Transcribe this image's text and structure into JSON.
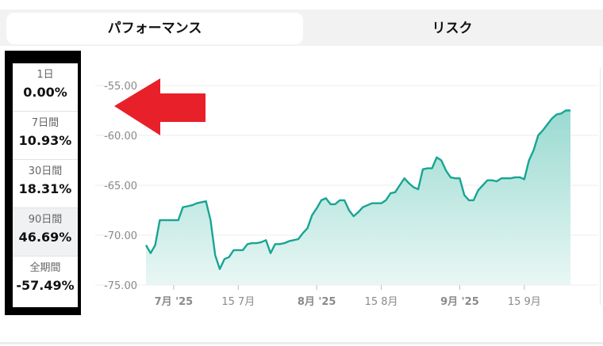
{
  "tabs": {
    "performance": "パフォーマンス",
    "risk": "リスク"
  },
  "periods": [
    {
      "label": "1日",
      "value": "0.00%"
    },
    {
      "label": "7日間",
      "value": "10.93%"
    },
    {
      "label": "30日間",
      "value": "18.31%"
    },
    {
      "label": "90日間",
      "value": "46.69%"
    },
    {
      "label": "全期間",
      "value": "-57.49%"
    }
  ],
  "selected_period": "90日間",
  "colors": {
    "line": "#17a594",
    "fill_top": "#8fd6cc",
    "fill_bottom": "#e6f6f3",
    "arrow": "#e8202a",
    "panel_border": "#000000"
  },
  "annotation_icon": "red-left-arrow-icon",
  "chart_data": {
    "type": "area",
    "title": "",
    "xlabel": "",
    "ylabel": "",
    "ylim": [
      -75,
      -55
    ],
    "yticks": [
      "-55.00",
      "-60.00",
      "-65.00",
      "-70.00",
      "-75.00"
    ],
    "xticks": [
      {
        "label": "7月 '25",
        "bold": true
      },
      {
        "label": "15 7月",
        "bold": false
      },
      {
        "label": "8月 '25",
        "bold": true
      },
      {
        "label": "15 8月",
        "bold": false
      },
      {
        "label": "9月 '25",
        "bold": true
      },
      {
        "label": "15 9月",
        "bold": false
      }
    ],
    "x_range": [
      "2025-06-25",
      "2025-09-25"
    ],
    "x_tick_dates": [
      "2025-07-01",
      "2025-07-15",
      "2025-08-01",
      "2025-08-15",
      "2025-09-01",
      "2025-09-15"
    ],
    "grid": true,
    "series": [
      {
        "x": [
          "2025-06-25",
          "2025-06-26",
          "2025-06-27",
          "2025-06-28",
          "2025-06-29",
          "2025-07-01",
          "2025-07-02",
          "2025-07-03",
          "2025-07-04",
          "2025-07-05",
          "2025-07-06",
          "2025-07-07",
          "2025-07-08",
          "2025-07-09",
          "2025-07-10",
          "2025-07-11",
          "2025-07-12",
          "2025-07-13",
          "2025-07-14",
          "2025-07-15",
          "2025-07-16",
          "2025-07-17",
          "2025-07-18",
          "2025-07-19",
          "2025-07-20",
          "2025-07-21",
          "2025-07-22",
          "2025-07-23",
          "2025-07-24",
          "2025-07-25",
          "2025-07-26",
          "2025-07-27",
          "2025-07-28",
          "2025-07-29",
          "2025-07-30",
          "2025-07-31",
          "2025-08-01",
          "2025-08-02",
          "2025-08-03",
          "2025-08-04",
          "2025-08-05",
          "2025-08-06",
          "2025-08-07",
          "2025-08-08",
          "2025-08-09",
          "2025-08-10",
          "2025-08-11",
          "2025-08-12",
          "2025-08-13",
          "2025-08-14",
          "2025-08-15",
          "2025-08-16",
          "2025-08-17",
          "2025-08-18",
          "2025-08-19",
          "2025-08-20",
          "2025-08-21",
          "2025-08-22",
          "2025-08-23",
          "2025-08-24",
          "2025-08-25",
          "2025-08-26",
          "2025-08-27",
          "2025-08-28",
          "2025-08-29",
          "2025-08-30",
          "2025-08-31",
          "2025-09-01",
          "2025-09-02",
          "2025-09-03",
          "2025-09-04",
          "2025-09-05",
          "2025-09-06",
          "2025-09-07",
          "2025-09-08",
          "2025-09-09",
          "2025-09-10",
          "2025-09-11",
          "2025-09-12",
          "2025-09-13",
          "2025-09-14",
          "2025-09-15",
          "2025-09-16",
          "2025-09-17",
          "2025-09-18",
          "2025-09-19",
          "2025-09-20",
          "2025-09-21",
          "2025-09-22",
          "2025-09-23",
          "2025-09-24",
          "2025-09-25"
        ],
        "y": [
          -71.0,
          -71.8,
          -71.0,
          -68.5,
          -68.5,
          -68.5,
          -68.5,
          -67.2,
          -67.1,
          -67.0,
          -66.8,
          -66.7,
          -66.6,
          -68.5,
          -72.0,
          -73.4,
          -72.4,
          -72.2,
          -71.5,
          -71.5,
          -71.5,
          -70.9,
          -70.8,
          -70.8,
          -70.7,
          -70.5,
          -71.8,
          -70.9,
          -70.9,
          -70.8,
          -70.6,
          -70.5,
          -70.4,
          -69.8,
          -69.3,
          -68.0,
          -67.3,
          -66.5,
          -66.3,
          -66.9,
          -66.9,
          -66.5,
          -66.5,
          -67.5,
          -68.1,
          -67.7,
          -67.2,
          -67.0,
          -66.8,
          -66.8,
          -66.8,
          -66.5,
          -65.8,
          -65.7,
          -65.0,
          -64.3,
          -64.8,
          -65.2,
          -65.4,
          -63.4,
          -63.3,
          -63.3,
          -62.2,
          -62.5,
          -63.5,
          -64.2,
          -64.3,
          -64.3,
          -66.0,
          -66.5,
          -66.5,
          -65.5,
          -65.0,
          -64.5,
          -64.5,
          -64.6,
          -64.3,
          -64.3,
          -64.3,
          -64.2,
          -64.2,
          -64.4,
          -62.5,
          -61.5,
          -60.0,
          -59.5,
          -58.9,
          -58.3,
          -57.9,
          -57.8,
          -57.5,
          -57.5
        ]
      }
    ]
  }
}
